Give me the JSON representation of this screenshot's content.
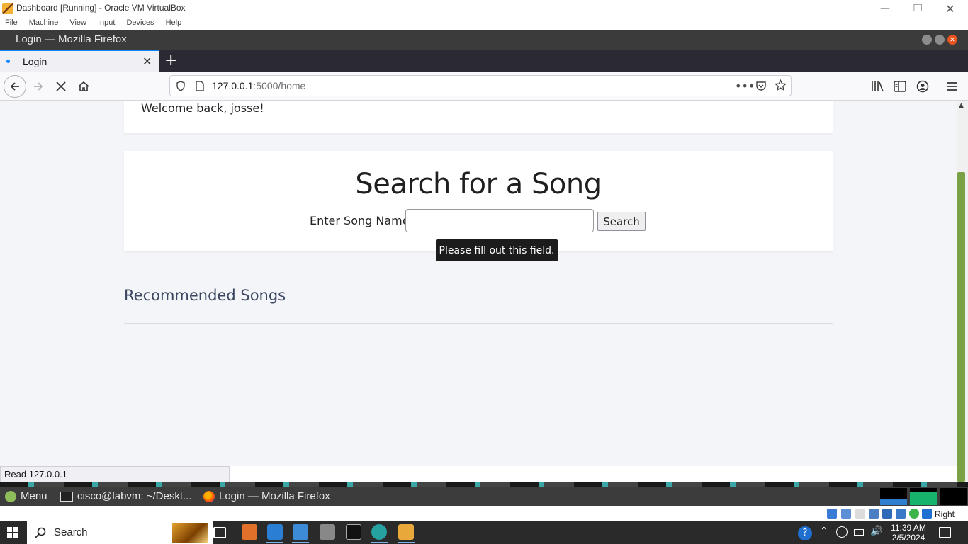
{
  "vbox": {
    "title": "Dashboard [Running] - Oracle VM VirtualBox",
    "menu": [
      "File",
      "Machine",
      "View",
      "Input",
      "Devices",
      "Help"
    ],
    "host_key_label": "Right Ctrl"
  },
  "firefox": {
    "window_title": "Login — Mozilla Firefox",
    "tab_label": "Login",
    "new_tab_symbol": "+",
    "url_host": "127.0.0.1",
    "url_path": ":5000/home",
    "status_text": "Read 127.0.0.1"
  },
  "page": {
    "welcome": "Welcome back, josse!",
    "search_heading": "Search for a Song",
    "song_label": "Enter Song Name:",
    "song_input_value": "",
    "search_button": "Search",
    "validation_tooltip": "Please fill out this field.",
    "recommended_heading": "Recommended Songs"
  },
  "guest_panel": {
    "menu_label": "Menu",
    "terminal_label": "cisco@labvm: ~/Deskt...",
    "firefox_label": "Login — Mozilla Firefox"
  },
  "taskbar": {
    "search_label": "Search",
    "time": "11:39 AM",
    "date": "2/5/2024"
  },
  "colors": {
    "firefox_tab_accent": "#0a84ff",
    "scroll_thumb": "#7aa145",
    "recommended_heading": "#3b4760",
    "ubuntu_close": "#e95420"
  }
}
